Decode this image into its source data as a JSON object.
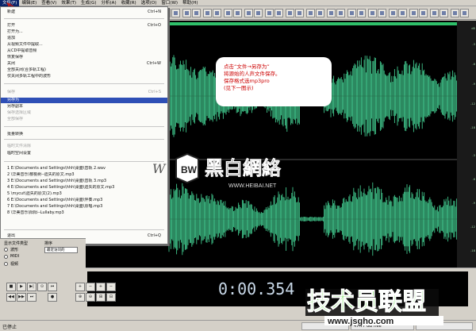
{
  "menubar": {
    "items": [
      "文件(F)",
      "编辑(E)",
      "查看(V)",
      "效果(T)",
      "生成(G)",
      "分析(A)",
      "收藏(R)",
      "选项(O)",
      "窗口(W)",
      "帮助(H)"
    ]
  },
  "file_menu": {
    "items": [
      {
        "label": "新建",
        "shortcut": "Ctrl+N",
        "state": "normal"
      },
      {
        "label": "打开",
        "shortcut": "Ctrl+O",
        "state": "normal"
      },
      {
        "label": "打开为...",
        "shortcut": "",
        "state": "normal"
      },
      {
        "label": "追加",
        "shortcut": "",
        "state": "normal"
      },
      {
        "label": "从视频文件中提取...",
        "shortcut": "",
        "state": "normal"
      },
      {
        "label": "从CD中提取音频",
        "shortcut": "",
        "state": "normal"
      },
      {
        "label": "恢复保存",
        "shortcut": "",
        "state": "normal"
      },
      {
        "label": "关闭",
        "shortcut": "Ctrl+W",
        "state": "normal"
      },
      {
        "label": "全部关闭(合多轨工程)",
        "shortcut": "",
        "state": "normal"
      },
      {
        "label": "仅关闭多轨工程中的波形",
        "shortcut": "",
        "state": "normal"
      },
      {
        "label": "保存",
        "shortcut": "Ctrl+S",
        "state": "disabled"
      },
      {
        "label": "另存为",
        "shortcut": "",
        "state": "selected"
      },
      {
        "label": "另存副本",
        "shortcut": "",
        "state": "normal"
      },
      {
        "label": "保存选择区域",
        "shortcut": "",
        "state": "disabled"
      },
      {
        "label": "全部保存",
        "shortcut": "",
        "state": "disabled"
      },
      {
        "label": "批量转换",
        "shortcut": "",
        "state": "normal"
      },
      {
        "label": "临时文件清除",
        "shortcut": "",
        "state": "disabled"
      },
      {
        "label": "临时空间设置",
        "shortcut": "",
        "state": "normal"
      },
      {
        "label": "1 E:\\Documents and Settings\\hhh\\桌面\\音轨 2.wav",
        "shortcut": "",
        "state": "normal"
      },
      {
        "label": "2 \\华美音乐\\樱桃树--遗失的原文.mp3",
        "shortcut": "",
        "state": "normal"
      },
      {
        "label": "3 E:\\Documents and Settings\\hhh\\桌面\\音轨 3.mp3",
        "shortcut": "",
        "state": "normal"
      },
      {
        "label": "4 E:\\Documents and Settings\\hhh\\桌面\\遗失的原文.mp3",
        "shortcut": "",
        "state": "normal"
      },
      {
        "label": "5 \\mycut\\遗失的原文(2).mp3",
        "shortcut": "",
        "state": "normal"
      },
      {
        "label": "6 E:\\Documents and Settings\\hhh\\桌面\\伴奏.mp3",
        "shortcut": "",
        "state": "normal"
      },
      {
        "label": "7 E:\\Documents and Settings\\hhh\\桌面\\原唱.mp3",
        "shortcut": "",
        "state": "normal"
      },
      {
        "label": "8 \\华美音乐\\阳阳--Lullaby.mp3",
        "shortcut": "",
        "state": "normal"
      },
      {
        "label": "退出",
        "shortcut": "Ctrl+Q",
        "state": "normal"
      }
    ]
  },
  "callout": {
    "line1": "点击“文件→另存为”",
    "line2": "将源始的人声文件保存。",
    "line3": "保存格式选mp3pro",
    "line4": "(见下一图示)"
  },
  "watermark_mid": {
    "logo": "BW",
    "title": "黑白網絡",
    "url": "WWW.HEIBAI.NET"
  },
  "watermark_bottom": {
    "title": "技术员联盟",
    "url": "www.jsgho.com"
  },
  "left_panel": {
    "label1": "显示文件类型",
    "label2": "排序",
    "opt1": "波形",
    "opt2": "MIDI",
    "opt3": "视频",
    "select": "最近访问的"
  },
  "transport": {
    "time": "0:00.354"
  },
  "status": {
    "text": "已停止",
    "disk": "47.77 GB free"
  },
  "ruler": {
    "labels": [
      "dB",
      "-3",
      "-6",
      "-9",
      "-12",
      "-18",
      "-3",
      "-6",
      "-9",
      "-12",
      "-18"
    ]
  },
  "colors": {
    "waveform": "#3fc48a",
    "menu_selection": "#2e4fb6",
    "callout_text": "#cc0000",
    "background": "#000000"
  }
}
